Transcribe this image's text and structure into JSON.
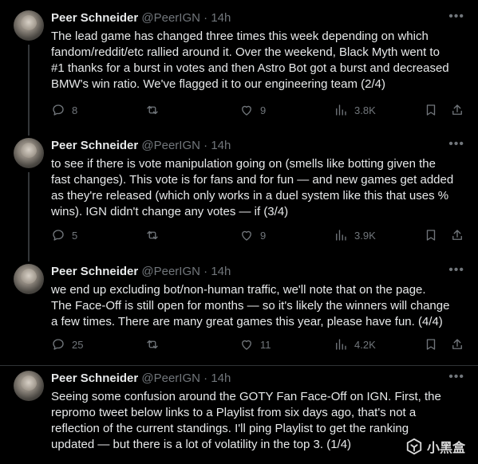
{
  "tweets": [
    {
      "name": "Peer Schneider",
      "handle": "@PeerIGN",
      "dot": "·",
      "time": "14h",
      "lines": [
        "The lead game has changed three times this week depending on which",
        "fandom/reddit/etc rallied around it. Over the weekend, Black Myth went to",
        "#1 thanks for a burst in votes and then Astro Bot got a burst and decreased",
        "BMW's win ratio. We've flagged it to our engineering team (2/4)"
      ],
      "replies": "8",
      "retweets": "",
      "likes": "9",
      "views": "3.8K"
    },
    {
      "name": "Peer Schneider",
      "handle": "@PeerIGN",
      "dot": "·",
      "time": "14h",
      "lines": [
        "to see if there is vote manipulation going on (smells like botting given the",
        "fast changes). This vote is for fans and for fun — and new games get added",
        "as they're released (which only works in a duel system like this that uses %",
        "wins).  IGN didn't change any votes — if (3/4)"
      ],
      "replies": "5",
      "retweets": "",
      "likes": "9",
      "views": "3.9K"
    },
    {
      "name": "Peer Schneider",
      "handle": "@PeerIGN",
      "dot": "·",
      "time": "14h",
      "lines": [
        "we end up excluding bot/non-human traffic, we'll note that on the page.",
        "The Face-Off is still open for months — so it's likely the winners will change",
        "a few times. There are many great games this year, please have fun. (4/4)"
      ],
      "replies": "25",
      "retweets": "",
      "likes": "11",
      "views": "4.2K"
    },
    {
      "name": "Peer Schneider",
      "handle": "@PeerIGN",
      "dot": "·",
      "time": "14h",
      "lines": [
        "Seeing some confusion around the GOTY Fan Face-Off on IGN. First, the",
        "repromo tweet below links to a Playlist from six days ago, that's not a",
        "reflection of the current standings. I'll ping Playlist to get the ranking",
        "updated — but there is a lot of volatility in the top 3. (1/4)"
      ]
    }
  ],
  "watermark": {
    "text": "小黑盒"
  },
  "colors": {
    "background": "#000000",
    "text": "#e7e9ea",
    "muted": "#71767b",
    "divider": "#2f3336"
  }
}
